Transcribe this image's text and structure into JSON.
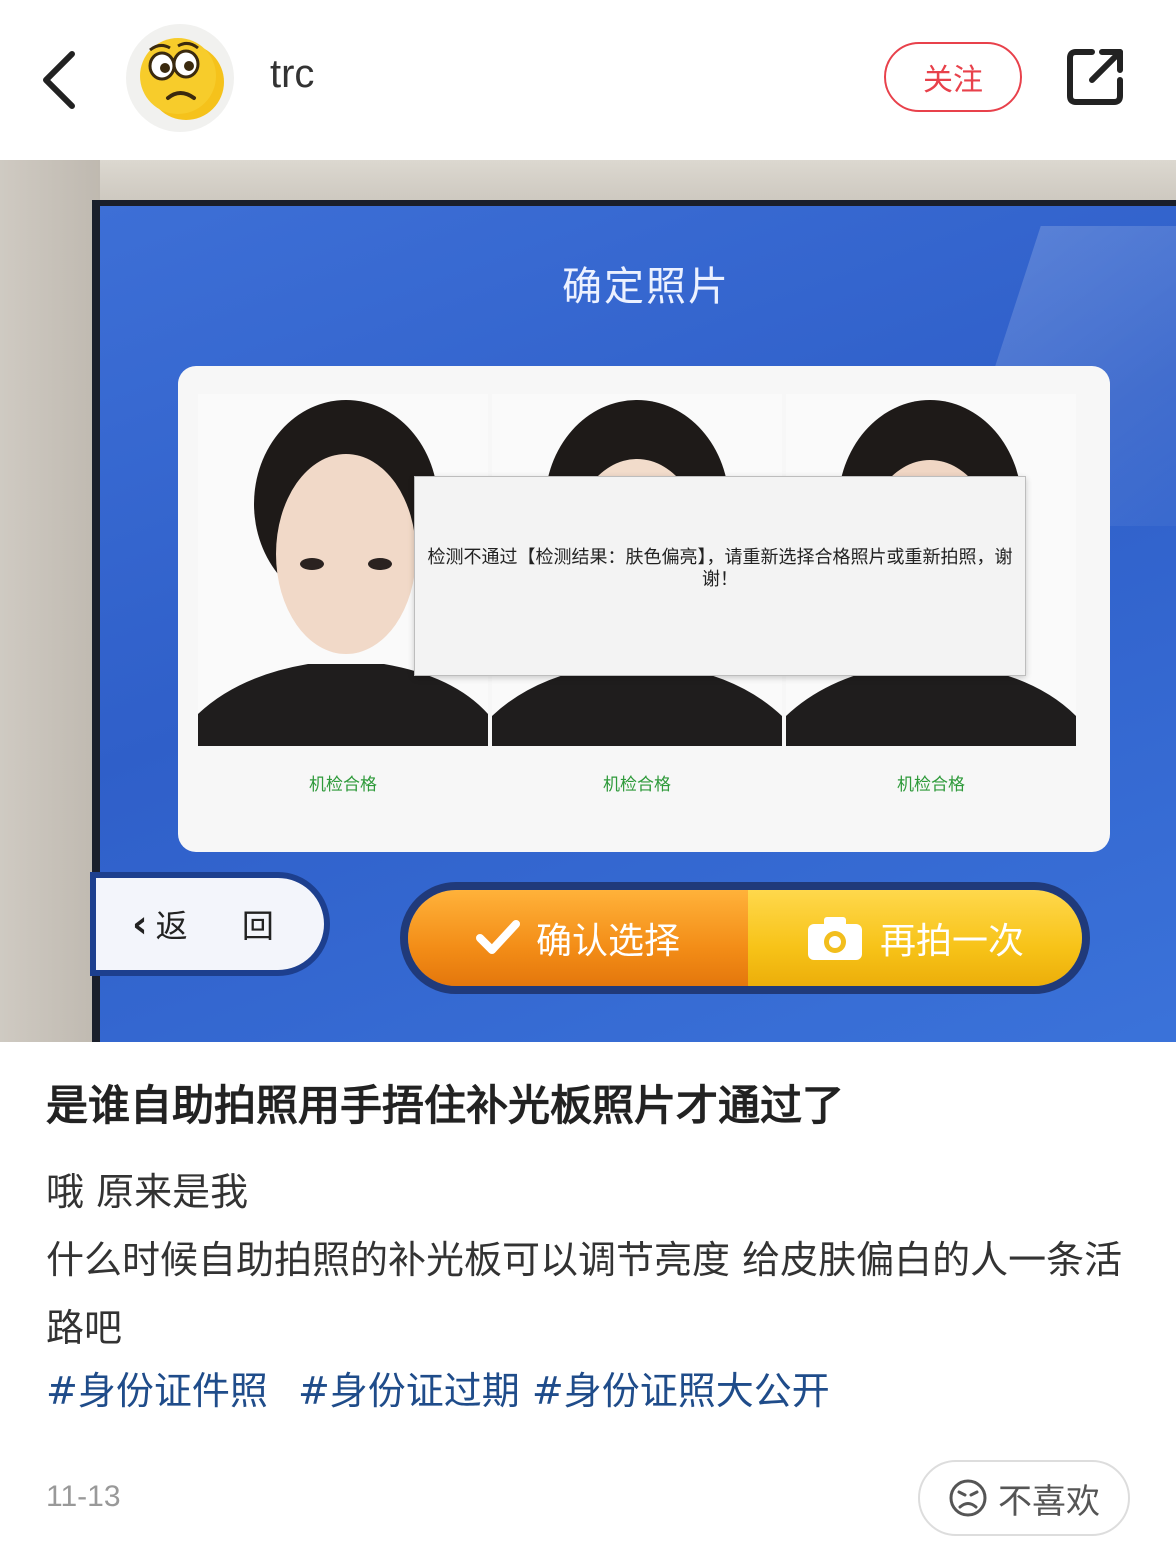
{
  "header": {
    "username": "trc",
    "follow_label": "关注",
    "back_icon": "chevron-left-icon",
    "share_icon": "share-icon"
  },
  "photo": {
    "screen_title": "确定照片",
    "error_message": "检测不通过【检测结果：肤色偏亮】，请重新选择合格照片或重新拍照，谢谢！",
    "verdicts": [
      "机检合格",
      "机检合格",
      "机检合格"
    ],
    "return_label": "返 回",
    "confirm_label": "确认选择",
    "retake_label": "再拍一次"
  },
  "post": {
    "title": "是谁自助拍照用手捂住补光板照片才通过了",
    "body_lines": [
      "哦 原来是我",
      "什么时候自助拍照的补光板可以调节亮度 给皮肤偏白的人一条活路吧"
    ],
    "tags": [
      "#身份证件照",
      "#身份证过期",
      "#身份证照大公开"
    ],
    "date": "11-13",
    "dislike_label": "不喜欢"
  },
  "colors": {
    "accent_red": "#e8414b",
    "tag_blue": "#1f4c8a",
    "pass_green": "#2e9a3a"
  }
}
